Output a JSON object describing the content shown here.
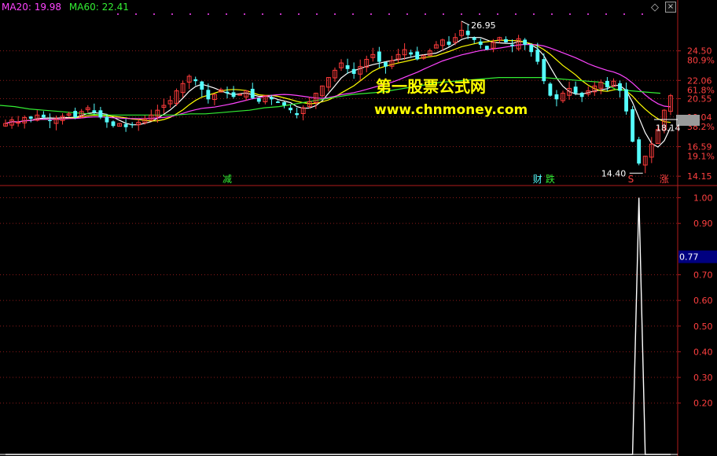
{
  "legend": {
    "ma20": {
      "label": "MA20: 19.98",
      "color": "#ff44ff"
    },
    "ma60": {
      "label": "MA60: 22.41",
      "color": "#33ee33"
    }
  },
  "watermark": {
    "line1": "第一股票公式网",
    "line2": "www.chnmoney.com"
  },
  "toolbar": {
    "diamond": "◇",
    "close": "×"
  },
  "colors": {
    "up": "#ff3b3b",
    "down": "#55ffff",
    "ma5": "#ffffff",
    "ma10": "#ffff00",
    "ma20": "#ff44ff",
    "ma60": "#33ee33",
    "grid": "#8b1a1a",
    "axis_text": "#ff4040",
    "highlight_bg": "#000080"
  },
  "chart_data": [
    {
      "type": "candlestick",
      "panel": "price",
      "y_ticks": [
        {
          "value": 24.5,
          "label": "24.50",
          "pct": "80.9%"
        },
        {
          "value": 22.06,
          "label": "22.06",
          "pct": "61.8%"
        },
        {
          "value": 20.55,
          "label": "20.55",
          "pct": ""
        },
        {
          "value": 19.04,
          "label": "19.04",
          "pct": "38.2%"
        },
        {
          "value": 16.59,
          "label": "16.59",
          "pct": "19.1%"
        },
        {
          "value": 14.15,
          "label": "14.15",
          "pct": ""
        }
      ],
      "ylim": [
        13.9,
        27.4
      ],
      "current_price": {
        "value": 18.14,
        "label": "18.14"
      },
      "annotations": [
        {
          "label": "26.95",
          "index": 72,
          "value": 26.95,
          "kind": "high"
        },
        {
          "label": "14.40",
          "index": 101,
          "value": 14.4,
          "kind": "low"
        }
      ],
      "event_markers": [
        {
          "label": "减",
          "index": 35,
          "color": "#33ee33"
        },
        {
          "label": "财",
          "index": 84,
          "color": "#55ffff"
        },
        {
          "label": "跌",
          "index": 86,
          "color": "#33ee33"
        },
        {
          "label": "S",
          "index": 99,
          "color": "#ff4040"
        },
        {
          "label": "涨",
          "index": 104,
          "color": "#ff4040"
        }
      ],
      "closes": [
        18.5,
        18.8,
        18.6,
        19.0,
        18.9,
        19.2,
        19.0,
        18.7,
        18.9,
        19.1,
        19.3,
        19.0,
        19.5,
        19.8,
        19.4,
        19.0,
        18.6,
        18.3,
        18.5,
        18.2,
        18.4,
        18.6,
        18.9,
        19.2,
        19.6,
        20.0,
        20.4,
        21.2,
        21.8,
        22.4,
        22.0,
        21.3,
        20.5,
        20.9,
        21.3,
        21.0,
        20.7,
        20.9,
        21.2,
        20.6,
        20.3,
        20.8,
        20.5,
        20.2,
        20.0,
        19.6,
        19.2,
        19.8,
        20.3,
        21.0,
        21.6,
        22.3,
        22.9,
        23.5,
        23.0,
        22.6,
        23.2,
        23.8,
        24.2,
        23.6,
        23.2,
        23.7,
        24.2,
        24.6,
        24.2,
        23.8,
        24.1,
        24.5,
        25.0,
        25.4,
        25.0,
        25.6,
        26.2,
        25.8,
        25.4,
        25.0,
        24.6,
        25.2,
        25.6,
        25.2,
        24.9,
        25.5,
        25.0,
        24.4,
        23.6,
        22.0,
        20.8,
        20.5,
        21.0,
        21.4,
        21.0,
        20.7,
        21.2,
        21.6,
        21.9,
        21.5,
        22.0,
        21.2,
        19.5,
        17.0,
        15.2,
        15.8,
        16.8,
        18.0,
        19.6,
        20.8
      ],
      "ma60": [
        20.0,
        19.9,
        19.7,
        19.6,
        19.5,
        19.4,
        19.3,
        19.2,
        19.2,
        19.2,
        19.2,
        19.2,
        19.2,
        19.3,
        19.3,
        19.4,
        19.5,
        19.6,
        19.8,
        19.9,
        20.1,
        20.3,
        20.5,
        20.7,
        20.9,
        21.0,
        21.1,
        21.3,
        21.5,
        21.7,
        21.9,
        22.0,
        22.1,
        22.2,
        22.3,
        22.3,
        22.3,
        22.3,
        22.2,
        22.1,
        22.0,
        21.9,
        21.3,
        21.2,
        21.1,
        21.0
      ],
      "ma60_start_index": 0,
      "sub_series_note": ""
    },
    {
      "type": "line",
      "panel": "indicator",
      "y_ticks": [
        {
          "value": 1.0,
          "label": "1.00"
        },
        {
          "value": 0.9,
          "label": "0.90"
        },
        {
          "value": 0.7,
          "label": "0.70"
        },
        {
          "value": 0.6,
          "label": "0.60"
        },
        {
          "value": 0.5,
          "label": "0.50"
        },
        {
          "value": 0.4,
          "label": "0.40"
        },
        {
          "value": 0.3,
          "label": "0.30"
        },
        {
          "value": 0.2,
          "label": "0.20"
        }
      ],
      "ylim": [
        0.0,
        1.02
      ],
      "current_value": {
        "value": 0.77,
        "label": "0.77"
      },
      "values_nonzero": [
        {
          "index": 99,
          "value": 0.0
        },
        {
          "index": 100,
          "value": 1.0
        },
        {
          "index": 101,
          "value": 0.0
        }
      ]
    }
  ]
}
